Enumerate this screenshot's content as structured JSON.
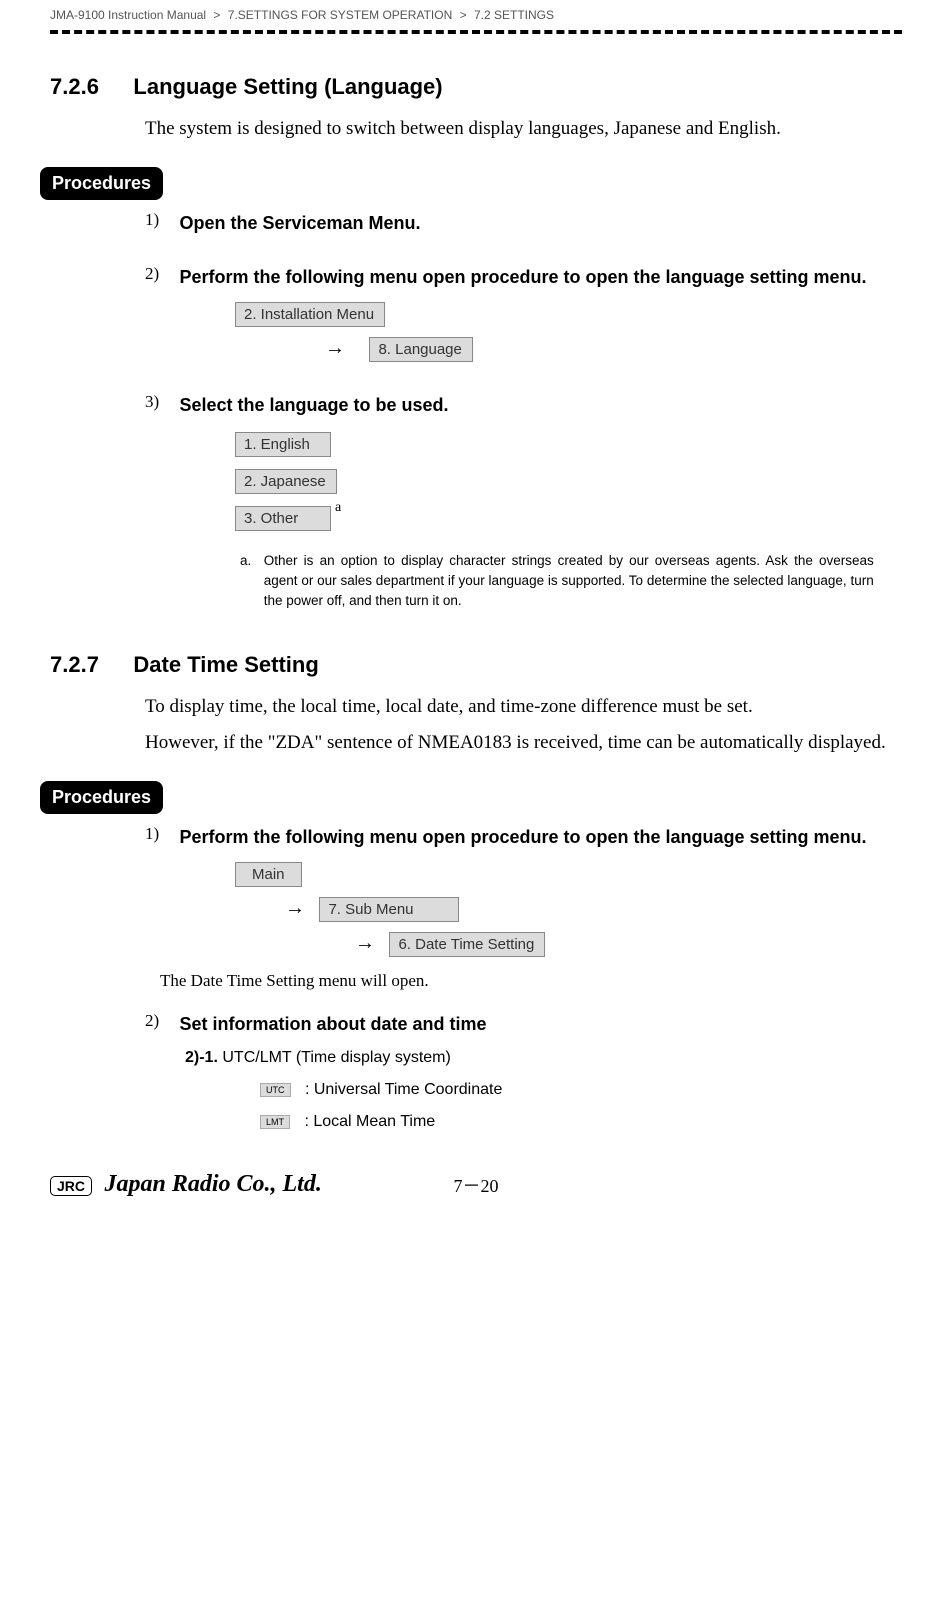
{
  "breadcrumb": {
    "manual": "JMA-9100 Instruction Manual",
    "chapter": "7.SETTINGS FOR SYSTEM OPERATION",
    "section": "7.2  SETTINGS"
  },
  "sec726": {
    "num": "7.2.6",
    "title": "Language Setting (Language)",
    "intro": "The system is designed to switch between display languages, Japanese and English.",
    "procedures_label": "Procedures",
    "step1_num": "1)",
    "step1_title": "Open the Serviceman Menu.",
    "step2_num": "2)",
    "step2_title": "Perform the following menu open procedure to open the language setting menu.",
    "menu_install": "2. Installation Menu",
    "arrow": "→",
    "menu_lang": "8. Language",
    "step3_num": "3)",
    "step3_title": "Select the language to be used.",
    "opt_en": "1. English",
    "opt_jp": "2. Japanese",
    "opt_other": "3. Other",
    "sup_a": "a",
    "footnote_ref": "a.",
    "footnote_text": "Other is an option to display character strings created by our overseas agents. Ask the overseas agent or our sales department if your language is supported. To determine the selected language, turn the power off, and then turn it on."
  },
  "sec727": {
    "num": "7.2.7",
    "title": "Date Time Setting",
    "intro1": "To display time, the local time, local date, and time-zone difference must be set.",
    "intro2": "However, if the \"ZDA\" sentence of NMEA0183 is received, time can be automatically displayed.",
    "procedures_label": "Procedures",
    "step1_num": "1)",
    "step1_title": "Perform the following menu open procedure to open the language setting menu.",
    "menu_main": "Main",
    "arrow": "→",
    "menu_sub": "7. Sub Menu",
    "menu_dt": "6. Date Time Setting",
    "after_note": "The Date Time Setting menu will open.",
    "step2_num": "2)",
    "step2_title": "Set information about date and time",
    "sub_num": "2)-1.",
    "sub_text": "UTC/LMT (Time display system)",
    "utc_chip": "UTC",
    "utc_desc": ": Universal Time Coordinate",
    "lmt_chip": "LMT",
    "lmt_desc": ": Local Mean Time"
  },
  "footer": {
    "jrc": "JRC",
    "company": "Japan Radio Co., Ltd.",
    "page": "7－20"
  }
}
